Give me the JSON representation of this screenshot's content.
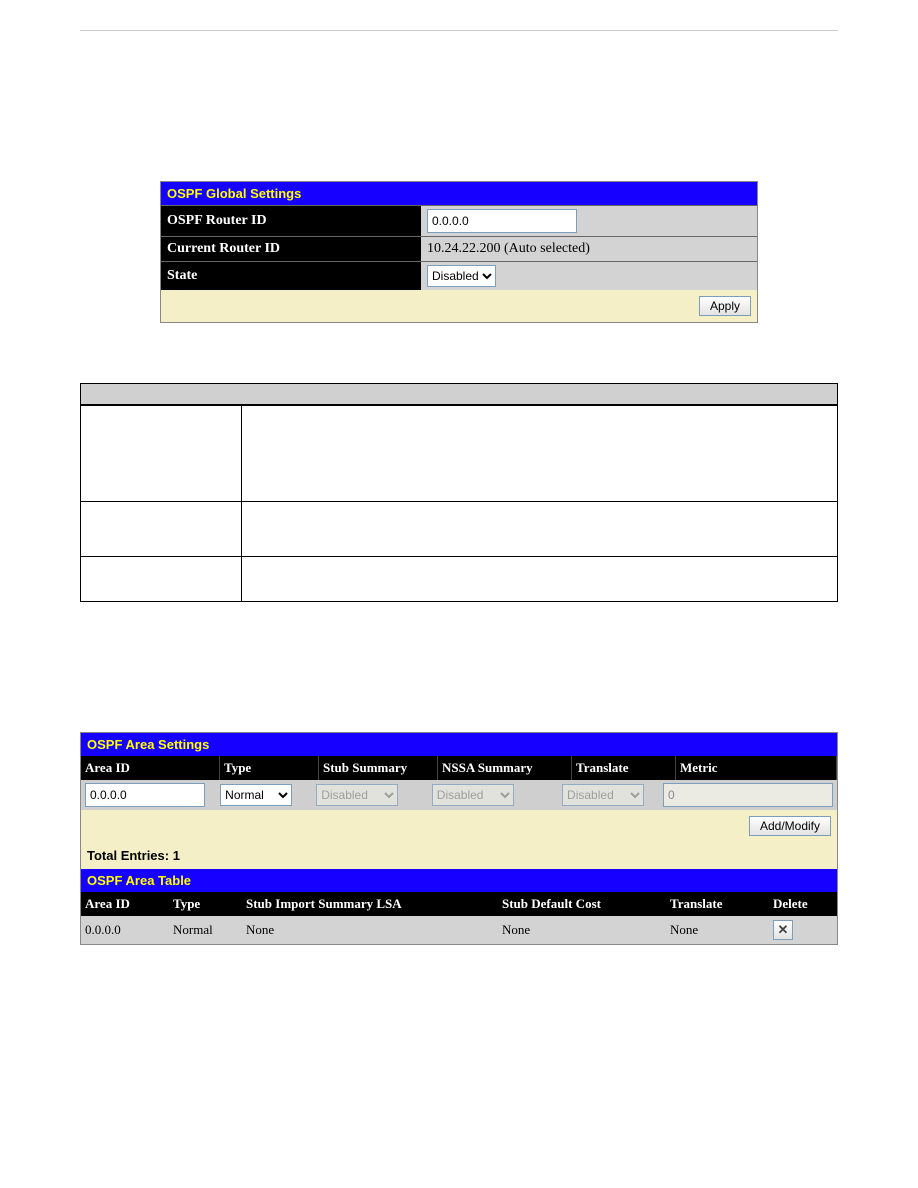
{
  "global_settings": {
    "title": "OSPF Global Settings",
    "router_id_label": "OSPF Router ID",
    "router_id_value": "0.0.0.0",
    "current_router_id_label": "Current Router ID",
    "current_router_id_value": "10.24.22.200 (Auto selected)",
    "state_label": "State",
    "state_value": "Disabled",
    "apply_label": "Apply"
  },
  "area_settings": {
    "title": "OSPF Area Settings",
    "headers": {
      "area_id": "Area ID",
      "type": "Type",
      "stub_summary": "Stub Summary",
      "nssa_summary": "NSSA Summary",
      "translate": "Translate",
      "metric": "Metric"
    },
    "inputs": {
      "area_id": "0.0.0.0",
      "type": "Normal",
      "stub_summary": "Disabled",
      "nssa_summary": "Disabled",
      "translate": "Disabled",
      "metric": "0"
    },
    "add_modify_label": "Add/Modify",
    "total_entries_label": "Total Entries: 1"
  },
  "area_table": {
    "title": "OSPF Area Table",
    "headers": {
      "area_id": "Area ID",
      "type": "Type",
      "stub_import": "Stub Import Summary LSA",
      "stub_default_cost": "Stub Default Cost",
      "translate": "Translate",
      "delete": "Delete"
    },
    "rows": [
      {
        "area_id": "0.0.0.0",
        "type": "Normal",
        "stub_import": "None",
        "stub_default_cost": "None",
        "translate": "None"
      }
    ]
  },
  "icons": {
    "close": "✕"
  }
}
